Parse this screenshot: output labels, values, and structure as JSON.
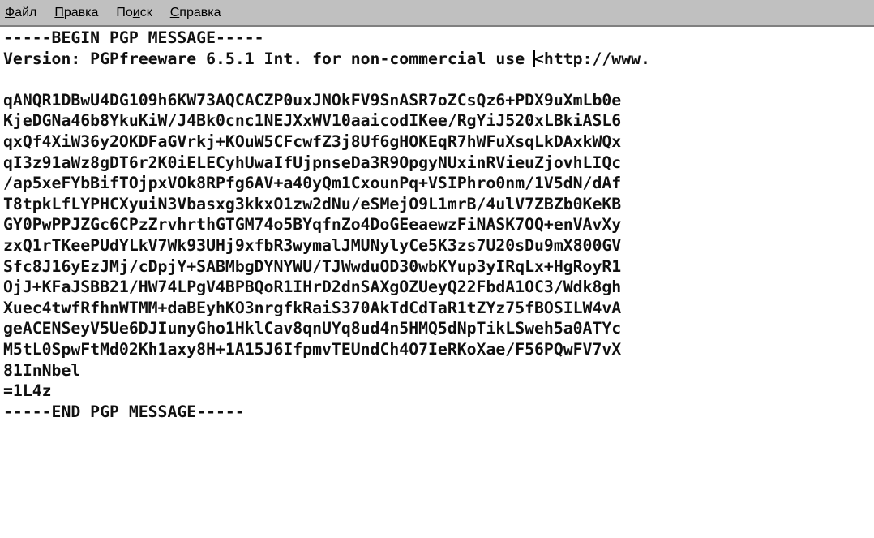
{
  "menu": {
    "items": [
      {
        "accel": "Ф",
        "rest": "айл"
      },
      {
        "accel": "П",
        "rest": "равка"
      },
      {
        "pre": "По",
        "accel": "и",
        "rest": "ск"
      },
      {
        "accel": "С",
        "rest": "правка"
      }
    ]
  },
  "editor": {
    "lines": [
      "-----BEGIN PGP MESSAGE-----",
      "Version: PGPfreeware 6.5.1 Int. for non-commercial use ",
      "",
      "qANQR1DBwU4DG109h6KW73AQCACZP0uxJNOkFV9SnASR7oZCsQz6+PDX9uXmLb0e",
      "KjeDGNa46b8YkuKiW/J4Bk0cnc1NEJXxWV10aaicodIKee/RgYiJ520xLBkiASL6",
      "qxQf4XiW36y2OKDFaGVrkj+KOuW5CFcwfZ3j8Uf6gHOKEqR7hWFuXsqLkDAxkWQx",
      "qI3z91aWz8gDT6r2K0iELECyhUwaIfUjpnseDa3R9OpgyNUxinRVieuZjovhLIQc",
      "/ap5xeFYbBifTOjpxVOk8RPfg6AV+a40yQm1CxounPq+VSIPhro0nm/1V5dN/dAf",
      "T8tpkLfLYPHCXyuiN3Vbasxg3kkxO1zw2dNu/eSMejO9L1mrB/4ulV7ZBZb0KeKB",
      "GY0PwPPJZGc6CPzZrvhrthGTGM74o5BYqfnZo4DoGEeaewzFiNASK7OQ+enVAvXy",
      "zxQ1rTKeePUdYLkV7Wk93UHj9xfbR3wymalJMUNylyCe5K3zs7U20sDu9mX800GV",
      "Sfc8J16yEzJMj/cDpjY+SABMbgDYNYWU/TJWwduOD30wbKYup3yIRqLx+HgRoyR1",
      "OjJ+KFaJSBB21/HW74LPgV4BPBQoR1IHrD2dnSAXgOZUeyQ22FbdA1OC3/Wdk8gh",
      "Xuec4twfRfhnWTMM+daBEyhKO3nrgfkRaiS370AkTdCdTaR1tZYz75fBOSILW4vA",
      "geACENSeyV5Ue6DJIunyGho1HklCav8qnUYq8ud4n5HMQ5dNpTikLSweh5a0ATYc",
      "M5tL0SpwFtMd02Kh1axy8H+1A15J6IfpmvTEUndCh4O7IeRKoXae/F56PQwFV7vX",
      "81InNbel",
      "=1L4z",
      "-----END PGP MESSAGE-----"
    ],
    "caret_line_suffix": "<http://www."
  }
}
